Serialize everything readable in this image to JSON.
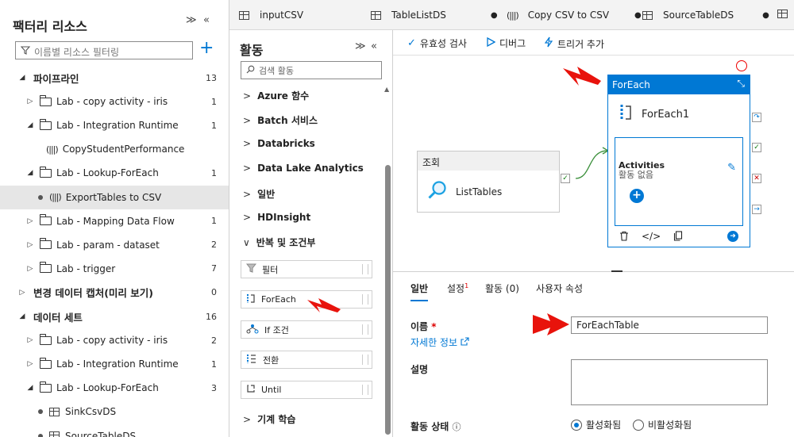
{
  "left_panel": {
    "title": "팩터리 리소스",
    "collapse_label": "≫",
    "close_label": "«",
    "filter_placeholder": "이름별 리소스 필터링",
    "add_label": "+",
    "tree": [
      {
        "label": "파이프라인",
        "count": "13",
        "kind": "section",
        "twisty": "◢"
      },
      {
        "label": "Lab - copy activity - iris",
        "count": "1",
        "kind": "folder",
        "twisty": "▷"
      },
      {
        "label": "Lab - Integration Runtime",
        "count": "1",
        "kind": "folder",
        "twisty": "◢"
      },
      {
        "label": "CopyStudentPerformance",
        "count": "",
        "kind": "pipeline",
        "twisty": ""
      },
      {
        "label": "Lab - Lookup-ForEach",
        "count": "1",
        "kind": "folder",
        "twisty": "◢"
      },
      {
        "label": "ExportTables to CSV",
        "count": "",
        "kind": "pipeline-selected",
        "twisty": ""
      },
      {
        "label": "Lab - Mapping Data Flow",
        "count": "1",
        "kind": "folder",
        "twisty": "▷"
      },
      {
        "label": "Lab - param - dataset",
        "count": "2",
        "kind": "folder",
        "twisty": "▷"
      },
      {
        "label": "Lab - trigger",
        "count": "7",
        "kind": "folder",
        "twisty": "▷"
      },
      {
        "label": "변경 데이터 캡처(미리 보기)",
        "count": "0",
        "kind": "section",
        "twisty": "▷"
      },
      {
        "label": "데이터 세트",
        "count": "16",
        "kind": "section",
        "twisty": "◢"
      },
      {
        "label": "Lab - copy activity - iris",
        "count": "2",
        "kind": "folder",
        "twisty": "▷"
      },
      {
        "label": "Lab - Integration Runtime",
        "count": "1",
        "kind": "folder",
        "twisty": "▷"
      },
      {
        "label": "Lab - Lookup-ForEach",
        "count": "3",
        "kind": "folder",
        "twisty": "◢"
      },
      {
        "label": "SinkCsvDS",
        "count": "",
        "kind": "dataset",
        "twisty": ""
      },
      {
        "label": "SourceTableDS",
        "count": "",
        "kind": "dataset",
        "twisty": ""
      }
    ]
  },
  "tabs": [
    {
      "label": "inputCSV",
      "dirty": "",
      "icon": "table-icon"
    },
    {
      "label": "TableListDS",
      "dirty": "●",
      "icon": "table-icon"
    },
    {
      "label": "Copy CSV to CSV",
      "dirty": "●",
      "icon": "pipeline-icon"
    },
    {
      "label": "SourceTableDS",
      "dirty": "●",
      "icon": "table-icon"
    }
  ],
  "activities_panel": {
    "title": "활동",
    "collapse_label": "≫",
    "close_label": "«",
    "search_placeholder": "검색 활동",
    "categories": [
      {
        "label": "Azure 함수",
        "chev": ">"
      },
      {
        "label": "Batch 서비스",
        "chev": ">"
      },
      {
        "label": "Databricks",
        "chev": ">"
      },
      {
        "label": "Data Lake Analytics",
        "chev": ">"
      },
      {
        "label": "일반",
        "chev": ">"
      },
      {
        "label": "HDInsight",
        "chev": ">"
      },
      {
        "label": "반복 및 조건부",
        "chev": "∨"
      }
    ],
    "items": [
      {
        "label": "필터",
        "icon": "filter-icon"
      },
      {
        "label": "ForEach",
        "icon": "foreach-icon"
      },
      {
        "label": "If 조건",
        "icon": "if-condition-icon"
      },
      {
        "label": "전환",
        "icon": "switch-icon"
      },
      {
        "label": "Until",
        "icon": "until-icon"
      }
    ],
    "bottom_category": {
      "label": "기계 학습",
      "chev": ">"
    }
  },
  "toolbar": {
    "validate_label": "유효성 검사",
    "debug_label": "디버그",
    "trigger_label": "트리거 추가"
  },
  "canvas": {
    "lookup": {
      "type_label": "조회",
      "name": "ListTables"
    },
    "foreach": {
      "type_label": "ForEach",
      "name": "ForEach1",
      "activities_label": "Activities",
      "no_activities_label": "활동 없음"
    }
  },
  "properties": {
    "tabs": [
      {
        "label": "일반",
        "badge": ""
      },
      {
        "label": "설정",
        "badge": "1"
      },
      {
        "label": "활동 (0)",
        "badge": ""
      },
      {
        "label": "사용자 속성",
        "badge": ""
      }
    ],
    "name_label": "이름",
    "required_mark": "*",
    "more_info_label": "자세한 정보",
    "name_value": "ForEachTable",
    "description_label": "설명",
    "state_label": "활동 상태",
    "state_options": [
      {
        "label": "활성화됨",
        "selected": true
      },
      {
        "label": "비활성화됨",
        "selected": false
      }
    ]
  },
  "colors": {
    "accent": "#0078d4",
    "annotation_red": "#e8130c",
    "success_green": "#107c10"
  }
}
